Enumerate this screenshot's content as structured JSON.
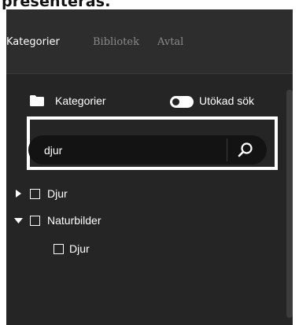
{
  "caption": "presenteras.",
  "tabs": [
    {
      "label": "Kategorier",
      "active": true
    },
    {
      "label": "Bibliotek",
      "active": false
    },
    {
      "label": "Avtal",
      "active": false
    }
  ],
  "category_header": {
    "label": "Kategorier",
    "icon": "folder-icon",
    "toggle_label": "Utökad sök",
    "toggle_on": false
  },
  "search": {
    "value": "djur",
    "placeholder": "",
    "button_icon": "search-icon"
  },
  "tree": [
    {
      "label": "Djur",
      "expanded": false,
      "checked": false
    },
    {
      "label": "Naturbilder",
      "expanded": true,
      "checked": false,
      "children": [
        {
          "label": "Djur",
          "checked": false
        }
      ]
    }
  ],
  "colors": {
    "panel_bg": "#252525",
    "tab_bar_bg": "#2d2d2d",
    "input_bg": "#131313",
    "highlight_frame": "#ffffff",
    "text": "#ffffff",
    "tab_inactive": "#8a8a8a"
  }
}
